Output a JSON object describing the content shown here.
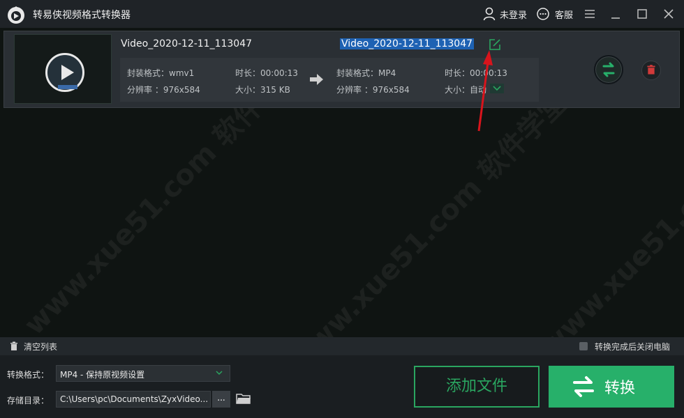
{
  "app": {
    "title": "转易侠视频格式转换器"
  },
  "titlebar": {
    "login_label": "未登录",
    "service_label": "客服"
  },
  "file": {
    "source_name": "Video_2020-12-11_113047",
    "target_name": "Video_2020-12-11_113047",
    "source": {
      "container_label": "封装格式：wmv1",
      "duration_label": "时长：00:00:13",
      "resolution_label": "分辨率    ：976x584",
      "size_label": "大小：315 KB"
    },
    "target": {
      "container_label": "封装格式：MP4",
      "duration_label": "时长：00:00:13",
      "resolution_label": "分辨率    ：976x584",
      "size_label": "大小：自动"
    }
  },
  "list_bar": {
    "clear_label": "清空列表",
    "shutdown_label": "转换完成后关闭电脑"
  },
  "bottom": {
    "format_label": "转换格式：",
    "format_value": "MP4 - 保持原视频设置",
    "dir_label": "存储目录：",
    "dir_value": "C:\\Users\\pc\\Documents\\ZyxVideo...",
    "browse_label": "...",
    "add_file_label": "添加文件",
    "convert_label": "转换"
  },
  "watermark": "www.xue51.com 软件学堂",
  "colors": {
    "accent": "#27b06a",
    "selection": "#1e62b3",
    "annotation": "#d8141c"
  }
}
